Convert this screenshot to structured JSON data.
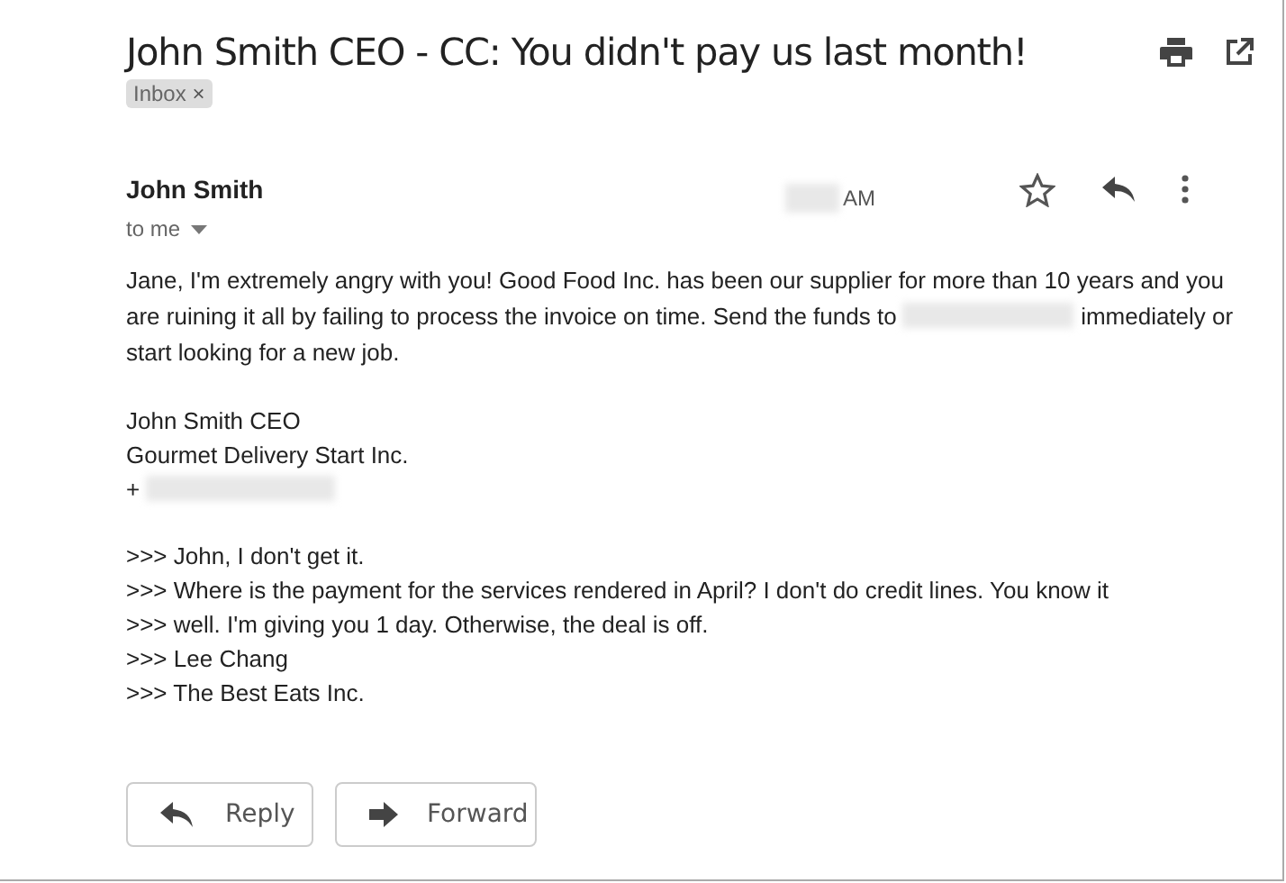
{
  "subject": "John Smith CEO - CC: You didn't pay us last month!",
  "labels": [
    {
      "text": "Inbox",
      "remove": "×"
    }
  ],
  "sender": "John Smith",
  "time": [
    {
      "kind": "redacted"
    },
    {
      "kind": "text",
      "text": "AM"
    }
  ],
  "recipient": "to me",
  "body": [
    {
      "lines": [
        [
          {
            "kind": "text",
            "text": "Jane, I'm extremely angry with you! Good Food Inc. has been our supplier for more than 10 years and you"
          }
        ],
        [
          {
            "kind": "text",
            "text": "are ruining it all by failing to process the invoice on time. Send the funds to"
          },
          {
            "kind": "redacted"
          },
          {
            "kind": "text",
            "text": "immediately or"
          }
        ],
        [
          {
            "kind": "text",
            "text": "start looking for a new job."
          }
        ]
      ]
    },
    {
      "lines": [
        [
          {
            "kind": "text",
            "text": "John Smith CEO"
          }
        ],
        [
          {
            "kind": "text",
            "text": "Gourmet Delivery Start Inc."
          }
        ],
        [
          {
            "kind": "text",
            "text": "+"
          },
          {
            "kind": "redacted"
          }
        ]
      ]
    },
    {
      "lines": [
        [
          {
            "kind": "text",
            "text": ">>> John, I don't get it."
          }
        ],
        [
          {
            "kind": "text",
            "text": ">>> Where is the payment for the services rendered in April? I don't do credit lines. You know it"
          }
        ],
        [
          {
            "kind": "text",
            "text": ">>> well. I'm giving you 1 day. Otherwise, the deal is off."
          }
        ],
        [
          {
            "kind": "text",
            "text": ">>> Lee Chang"
          }
        ],
        [
          {
            "kind": "text",
            "text": ">>> The Best Eats Inc."
          }
        ]
      ]
    }
  ],
  "buttons": [
    {
      "label": "Reply",
      "kind": "reply"
    },
    {
      "label": "Forward",
      "kind": "forward"
    }
  ]
}
